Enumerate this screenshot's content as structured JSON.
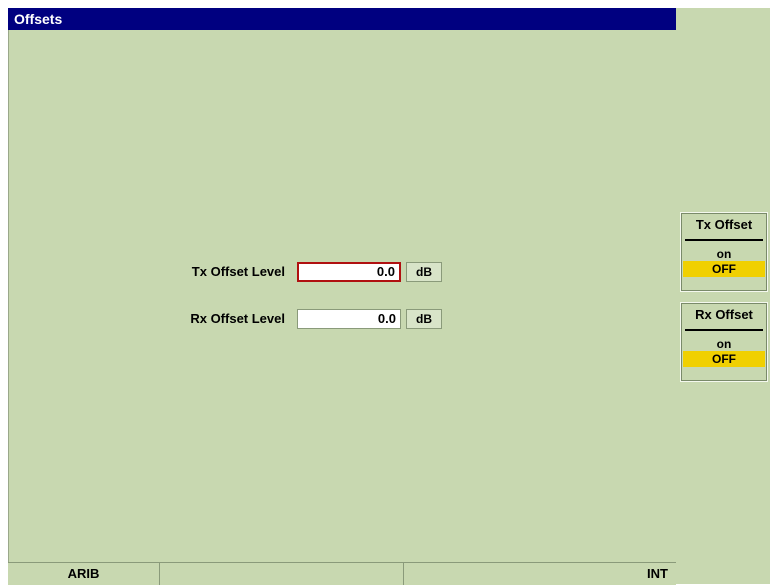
{
  "window": {
    "title": "Offsets"
  },
  "fields": [
    {
      "label": "Tx Offset Level",
      "value": "0.0",
      "unit": "dB",
      "focused": true
    },
    {
      "label": "Rx Offset Level",
      "value": "0.0",
      "unit": "dB",
      "focused": false
    }
  ],
  "softkeys": [
    {
      "title": "Tx Offset",
      "on_label": "on",
      "off_label": "OFF",
      "state": "OFF"
    },
    {
      "title": "Rx Offset",
      "on_label": "on",
      "off_label": "OFF",
      "state": "OFF"
    }
  ],
  "status_bar": {
    "standard": "ARIB",
    "middle": "",
    "reference": "INT"
  },
  "colors": {
    "background": "#c8d8b0",
    "title_bar": "#000080",
    "focus_border": "#b01010",
    "active_state": "#f0d000"
  }
}
